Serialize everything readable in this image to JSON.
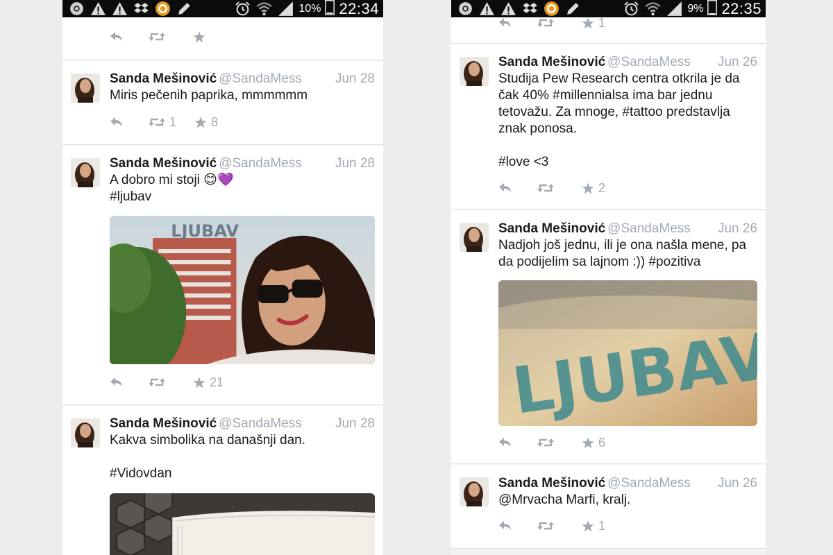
{
  "screens": [
    {
      "status": {
        "battery": "10%",
        "clock": "22:34"
      },
      "tweets": [
        {
          "name": "",
          "handle": "",
          "date": "",
          "lines": [],
          "retweets": "",
          "favorites": ""
        },
        {
          "name": "Sanda Mešinović",
          "handle": "@SandaMess",
          "date": "Jun 28",
          "lines": [
            "Miris pečenih paprika, mmmmmm"
          ],
          "retweets": "1",
          "favorites": "8"
        },
        {
          "name": "Sanda Mešinović",
          "handle": "@SandaMess",
          "date": "Jun 28",
          "lines": [
            "A dobro mi stoji 😊💜",
            "#ljubav"
          ],
          "retweets": "",
          "favorites": "21",
          "media_text": "LJUBAV"
        },
        {
          "name": "Sanda Mešinović",
          "handle": "@SandaMess",
          "date": "Jun 28",
          "lines": [
            "Kakva simbolika na današnji dan.",
            "",
            "#Vidovdan"
          ],
          "retweets": "",
          "favorites": ""
        }
      ]
    },
    {
      "status": {
        "battery": "9%",
        "clock": "22:35"
      },
      "tweets": [
        {
          "name": "",
          "handle": "",
          "date": "",
          "lines": [],
          "retweets": "",
          "favorites": "1"
        },
        {
          "name": "Sanda Mešinović",
          "handle": "@SandaMess",
          "date": "Jun 26",
          "lines": [
            "Studija Pew Research centra otkrila je da",
            "čak 40% #millennialsa ima bar jednu",
            "tetovažu. Za mnoge, #tattoo predstavlja",
            "znak ponosa.",
            "",
            "#love <3"
          ],
          "retweets": "",
          "favorites": "2"
        },
        {
          "name": "Sanda Mešinović",
          "handle": "@SandaMess",
          "date": "Jun 26",
          "lines": [
            "Nadjoh još jednu, ili je ona našla mene, pa",
            "da podijelim sa lajnom :)) #pozitiva"
          ],
          "retweets": "",
          "favorites": "6",
          "media_text": "LJUBAV"
        },
        {
          "name": "Sanda Mešinović",
          "handle": "@SandaMess",
          "date": "Jun 26",
          "lines": [
            "@Mrvacha Marfi, kralj."
          ],
          "retweets": "",
          "favorites": "1"
        }
      ]
    }
  ],
  "icons": {
    "status_left": [
      "chrome-icon",
      "warning-icon",
      "warning-icon",
      "dropbox-icon",
      "app-icon",
      "pencil-icon"
    ],
    "status_right": [
      "alarm-icon",
      "wifi-icon",
      "signal-icon",
      "battery-icon"
    ],
    "tweet_actions": [
      "reply-icon",
      "retweet-icon",
      "favorite-icon"
    ]
  },
  "colors": {
    "action_gray": "#a3aab2",
    "name": "#1a1a1a",
    "card": "#ffffff",
    "background": "#ecedef"
  }
}
